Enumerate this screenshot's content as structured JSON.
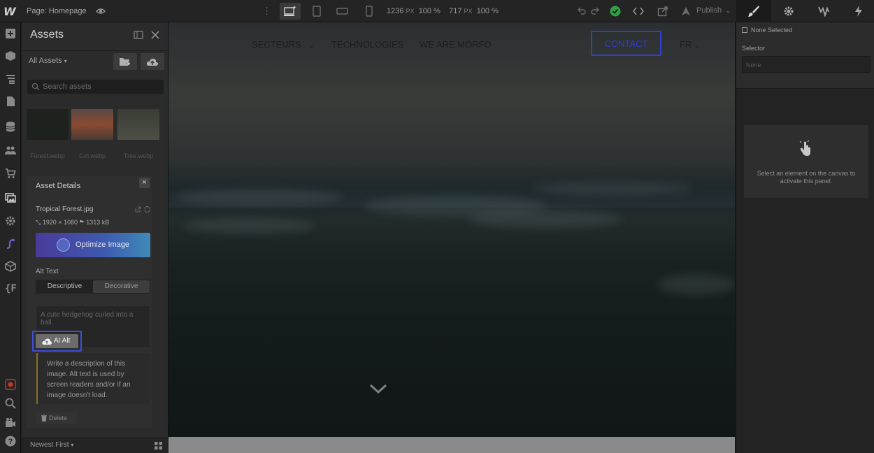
{
  "topbar": {
    "logo": "W",
    "page_label": "Page: Homepage",
    "width_value": "1236",
    "width_unit": "PX",
    "width_zoom": "100 %",
    "height_value": "717",
    "height_unit": "PX",
    "height_zoom": "100 %",
    "publish_label": "Publish"
  },
  "assets": {
    "title": "Assets",
    "filter_label": "All Assets",
    "search_placeholder": "Search assets",
    "thumbnails": [
      {
        "caption": "Forest.webp",
        "color": "#2a2e2a"
      },
      {
        "caption": "Girl.webp",
        "color": "#7a4a3a"
      },
      {
        "caption": "Tree.webp",
        "color": "#4a4d44"
      }
    ],
    "details": {
      "title": "Asset Details",
      "close_label": "×",
      "file_name": "Tropical Forest.jpg",
      "dimensions": "1920 × 1080",
      "file_size": "1313 kB",
      "optimize_label": "Optimize Image",
      "alt_text_label": "Alt Text",
      "alt_options": [
        "Descriptive",
        "Decorative"
      ],
      "alt_placeholder": "A cute hedgehog curled into a ball",
      "ai_alt_label": "AI Alt",
      "hint": "Write a description of this image. Alt text is used by screen readers and/or if an image doesn't load.",
      "delete_label": "Delete"
    },
    "sort_label": "Newest First"
  },
  "canvas": {
    "nav": [
      "SECTEURS",
      "TECHNOLOGIES",
      "WE ARE MORFO"
    ],
    "contact_label": "CONTACT",
    "language": "FR"
  },
  "right_panel": {
    "none_selected": "None Selected",
    "selector_label": "Selector",
    "selector_value": "None",
    "empty_message": "Select an element on the canvas to activate this panel."
  },
  "colors": {
    "accent": "#2f3fd0",
    "success": "#2ea043",
    "hint_border": "#8a6d1e"
  }
}
